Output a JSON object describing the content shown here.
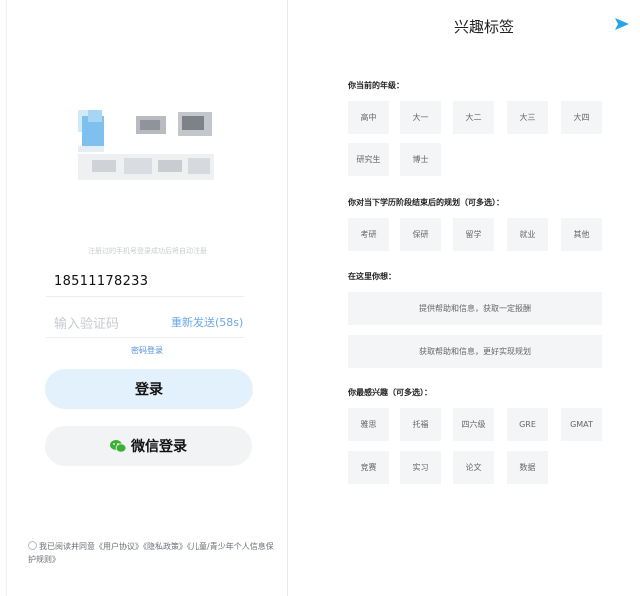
{
  "login": {
    "hint": "注册过的手机号登录成功后将自动注册",
    "phone_value": "18511178233",
    "code_placeholder": "输入验证码",
    "resend_label": "重新发送(58s)",
    "password_login": "密码登录",
    "login_button": "登录",
    "wechat_button": "微信登录",
    "agreement": {
      "prefix": "我已阅读并同意",
      "user_agreement": "《用户协议》",
      "privacy_policy": "《隐私政策》",
      "child_policy": "《儿童/青少年个人信息保护规则》"
    }
  },
  "tags_page": {
    "title": "兴趣标签",
    "grade": {
      "label": "你当前的年级：",
      "options": [
        "高中",
        "大一",
        "大二",
        "大三",
        "大四",
        "研究生",
        "博士"
      ]
    },
    "plan": {
      "label": "你对当下学历阶段结束后的规划（可多选）：",
      "options": [
        "考研",
        "保研",
        "留学",
        "就业",
        "其他"
      ]
    },
    "want": {
      "label": "在这里你想：",
      "options": [
        "提供帮助和信息，获取一定报酬",
        "获取帮助和信息，更好实现规划"
      ]
    },
    "interest": {
      "label": "你最感兴趣（可多选）：",
      "options": [
        "雅思",
        "托福",
        "四六级",
        "GRE",
        "GMAT",
        "竞赛",
        "实习",
        "论文",
        "数据"
      ]
    }
  },
  "colors": {
    "accent": "#4d8fdc",
    "login_bg": "#e3f1fc",
    "wechat_green": "#3cb034",
    "tag_bg": "#f4f5f7"
  }
}
